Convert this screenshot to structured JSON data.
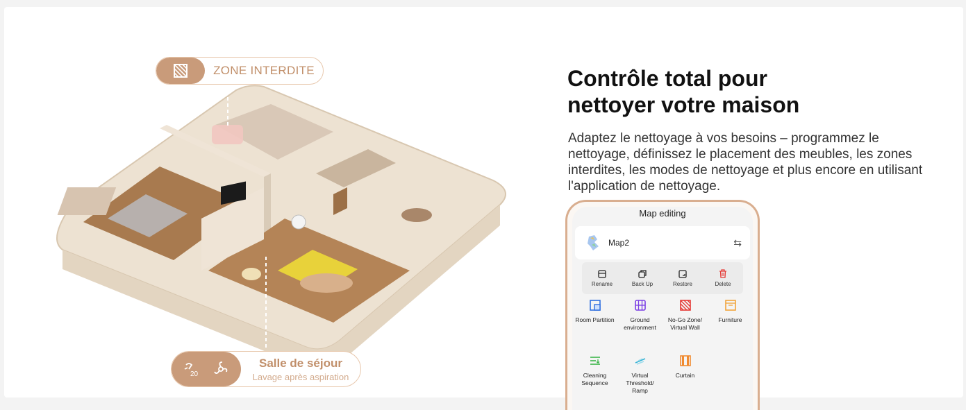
{
  "zone_label": "ZONE INTERDITE",
  "room": {
    "name": "Salle de séjour",
    "mode": "Lavage après aspiration"
  },
  "headline": {
    "line1": "Contrôle total pour",
    "line2": "nettoyer votre maison"
  },
  "description": "Adaptez le nettoyage à vos besoins – programmez le nettoyage, définissez le placement des meubles, les zones interdites, les modes de nettoyage et plus encore en utilisant l'application de nettoyage.",
  "phone": {
    "title": "Map editing",
    "map_name": "Map2",
    "actions": [
      {
        "label": "Rename",
        "icon": "rename-icon"
      },
      {
        "label": "Back Up",
        "icon": "backup-icon"
      },
      {
        "label": "Restore",
        "icon": "restore-icon"
      },
      {
        "label": "Delete",
        "icon": "trash-icon"
      }
    ],
    "tools": [
      {
        "label": "Room Partition",
        "icon": "room-partition-icon",
        "color": "#2f6fe0"
      },
      {
        "label": "Ground environment",
        "icon": "ground-environment-icon",
        "color": "#7b3fe4"
      },
      {
        "label": "No-Go Zone/ Virtual Wall",
        "icon": "no-go-zone-icon",
        "color": "#e53935"
      },
      {
        "label": "Furniture",
        "icon": "furniture-icon",
        "color": "#f2a33a"
      },
      {
        "label": "Cleaning Sequence",
        "icon": "cleaning-sequence-icon",
        "color": "#3cb54a"
      },
      {
        "label": "Virtual Threshold/ Ramp",
        "icon": "virtual-threshold-icon",
        "color": "#37b3d6"
      },
      {
        "label": "Curtain",
        "icon": "curtain-icon",
        "color": "#f08a30"
      }
    ]
  },
  "colors": {
    "accent": "#c99b7a",
    "accent_text": "#c18f6a",
    "phone_frame": "#d9ae8f"
  }
}
